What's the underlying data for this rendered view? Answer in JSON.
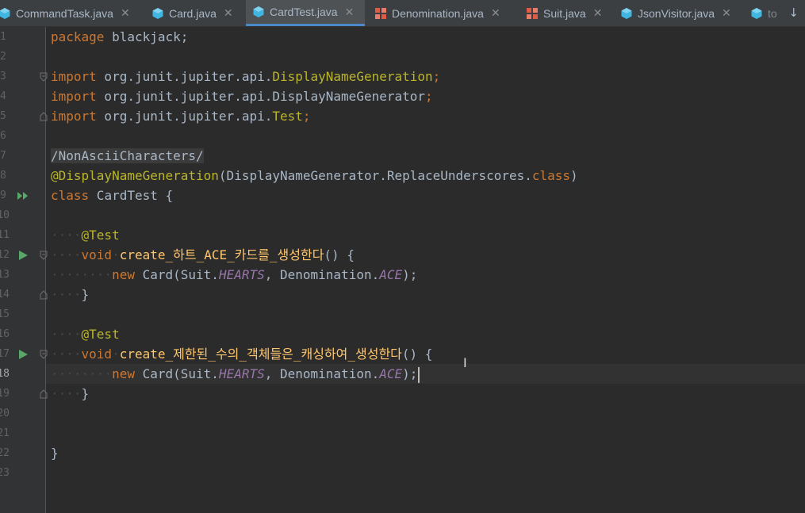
{
  "tabs": [
    {
      "name": "CommandTask.java",
      "icon": "class",
      "active": false
    },
    {
      "name": "Card.java",
      "icon": "class",
      "active": false
    },
    {
      "name": "CardTest.java",
      "icon": "class",
      "active": true
    },
    {
      "name": "Denomination.java",
      "icon": "enum",
      "active": false
    },
    {
      "name": "Suit.java",
      "icon": "enum",
      "active": false
    },
    {
      "name": "JsonVisitor.java",
      "icon": "class",
      "active": false
    },
    {
      "name": "to",
      "icon": "class",
      "active": false
    }
  ],
  "tab_close_glyph": "✕",
  "overflow_glyph": "↓",
  "line_numbers": [
    "1",
    "2",
    "3",
    "4",
    "5",
    "6",
    "7",
    "8",
    "9",
    "10",
    "11",
    "12",
    "13",
    "14",
    "15",
    "16",
    "17",
    "18",
    "19",
    "20",
    "21",
    "22",
    "23"
  ],
  "current_line": "18",
  "code": {
    "l1": {
      "kw": "package",
      "rest": " blackjack;"
    },
    "l3": {
      "kw": "import",
      "pkg": " org.junit.jupiter.api.",
      "cls": "DisplayNameGeneration",
      "semi": ";"
    },
    "l4": {
      "kw": "import",
      "pkg": " org.junit.jupiter.api.DisplayNameGenerator",
      "semi": ";"
    },
    "l5": {
      "kw": "import",
      "pkg": " org.junit.jupiter.api.",
      "cls": "Test",
      "semi": ";"
    },
    "l7": {
      "text": "/NonAsciiCharacters/"
    },
    "l8": {
      "ann": "@DisplayNameGeneration",
      "open": "(DisplayNameGenerator.ReplaceUnderscores.",
      "kw": "class",
      "close": ")"
    },
    "l9": {
      "kw": "class",
      "name": " CardTest {"
    },
    "l11": {
      "ann": "@Test"
    },
    "l12": {
      "kw": "void",
      "fn": "create_하트_ACE_카드를_생성한다",
      "rest": "() {"
    },
    "l13": {
      "kw": "new",
      "a": " Card(Suit.",
      "s1": "HEARTS",
      "b": ", Denomination.",
      "s2": "ACE",
      "c": ");"
    },
    "l14": {
      "text": "}"
    },
    "l16": {
      "ann": "@Test"
    },
    "l17": {
      "kw": "void",
      "fn": "create_제한된_수의_객체들은_캐싱하여_생성한다",
      "rest": "() {"
    },
    "l18": {
      "kw": "new",
      "a": " Card(Suit.",
      "s1": "HEARTS",
      "b": ", Denomination.",
      "s2": "ACE",
      "c": ");"
    },
    "l19": {
      "text": "}"
    },
    "l22": {
      "text": "}"
    }
  },
  "colors": {
    "background": "#2b2b2b",
    "gutter": "#313335",
    "keyword": "#cc7832",
    "annotation": "#bbb529",
    "method": "#ffc66d",
    "static_field": "#9876aa",
    "text": "#a9b7c6",
    "run_icon": "#59a869",
    "active_tab_underline": "#4a88c7"
  },
  "icons": {
    "run_single": "run-test-icon",
    "run_class": "run-all-tests-icon",
    "fold": "fold-marker-icon",
    "class_file": "java-class-icon",
    "enum_file": "java-enum-icon"
  }
}
